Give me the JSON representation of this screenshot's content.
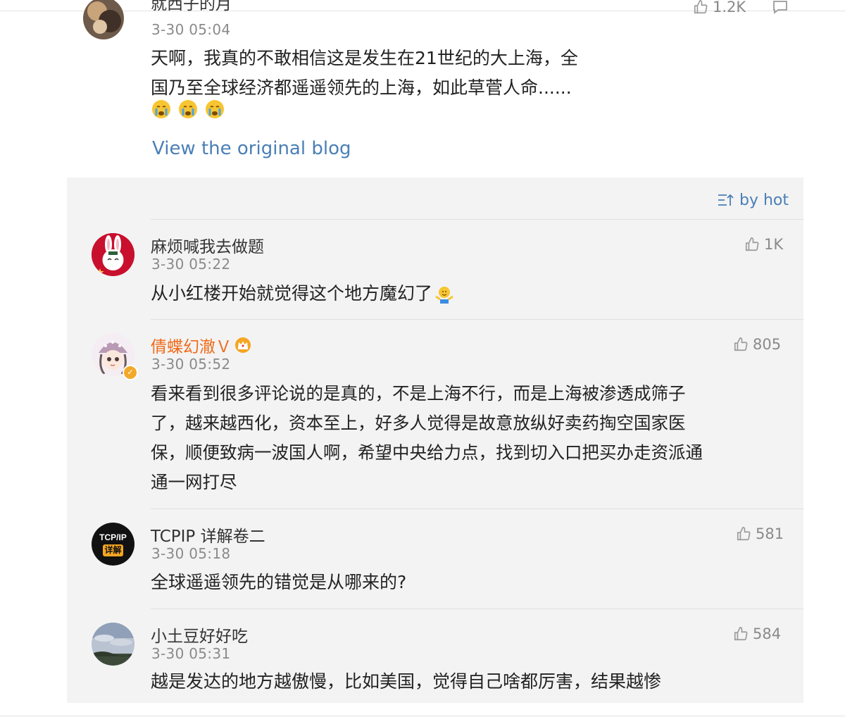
{
  "post": {
    "author_name": "就西子的月",
    "time": "3-30 05:04",
    "likes": "1.2K",
    "text_line1": "天啊，我真的不敢相信这是发生在21世纪的大上海，全",
    "text_line2": "国乃至全球经济都遥遥领先的上海，如此草菅人命......",
    "emojis": [
      "crying-face-emoji",
      "crying-face-emoji",
      "crying-face-emoji"
    ],
    "view_original_label": "View the original blog"
  },
  "comments_panel": {
    "sort_label": "by hot",
    "comments": [
      {
        "name": "麻烦喊我去做题",
        "time": "3-30 05:22",
        "likes": "1K",
        "text": "从小红楼开始就觉得这个地方魔幻了",
        "trailing_emoji": "shrug-emoji"
      },
      {
        "name": "倩蝶幻澈Ｖ",
        "time": "3-30 05:52",
        "likes": "805",
        "verified": true,
        "name_color": "#ef6b1a",
        "badge": "crown-icon",
        "text_lines": [
          "看来看到很多评论说的是真的，不是上海不行，而是上海被渗透成筛子",
          "了，越来越西化，资本至上，好多人觉得是故意放纵好卖药掏空国家医",
          "保，顺便致病一波国人啊，希望中央给力点，找到切入口把买办走资派通",
          "通一网打尽"
        ]
      },
      {
        "name": "TCPIP 详解卷二",
        "time": "3-30 05:18",
        "likes": "581",
        "avatar_text_top": "TCP/IP",
        "avatar_text_bottom": "详解",
        "text": "全球遥遥领先的错觉是从哪来的?"
      },
      {
        "name": "小土豆好好吃",
        "time": "3-30 05:31",
        "likes": "584",
        "text": "越是发达的地方越傲慢，比如美国，觉得自己啥都厉害，结果越惨"
      }
    ]
  },
  "colors": {
    "link": "#4a7fb6",
    "vip_name": "#ef6b1a",
    "panel_bg": "#f3f3f3",
    "muted": "#8a8a8a"
  }
}
